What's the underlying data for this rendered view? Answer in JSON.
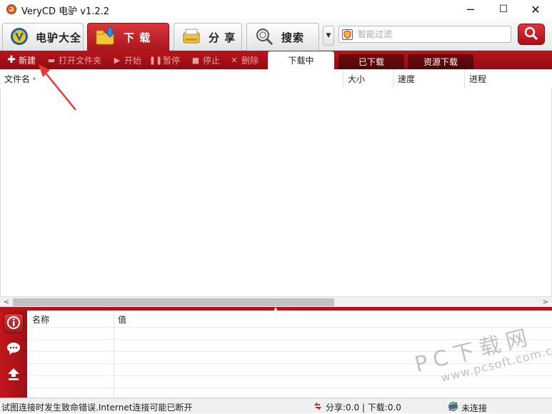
{
  "window": {
    "title": "VeryCD 电驴 v1.2.2",
    "minimize_glyph": "─",
    "maximize_glyph": "☐",
    "close_glyph": "✕"
  },
  "main_tabs": [
    {
      "label": "电驴大全",
      "icon": "verycd-logo-icon",
      "active": false
    },
    {
      "label": "下 载",
      "icon": "download-folder-icon",
      "active": true
    },
    {
      "label": "分 享",
      "icon": "share-drive-icon",
      "active": false
    },
    {
      "label": "搜索",
      "icon": "search-magnifier-icon",
      "active": false
    }
  ],
  "tab_dropdown_glyph": "▼",
  "filter": {
    "placeholder": "智能过滤",
    "value": ""
  },
  "toolbar": {
    "new_label": "新建",
    "open_folder_label": "打开文件夹",
    "start_label": "开始",
    "pause_label": "暂停",
    "stop_label": "停止",
    "delete_label": "删除"
  },
  "sub_tabs": {
    "downloading": "下载中",
    "downloaded": "已下载",
    "resource": "资源下载"
  },
  "list": {
    "columns": [
      "文件名",
      "大小",
      "速度",
      "进程"
    ],
    "rows": []
  },
  "scroll_glyphs": {
    "left": "<",
    "right": ">",
    "grip": "▲"
  },
  "properties": {
    "columns": [
      "名称",
      "值"
    ],
    "rows": []
  },
  "status": {
    "message": "试图连接时发生致命错误.Internet连接可能已断开",
    "transfer": "分享:0.0 | 下载:0.0",
    "connection": "未连接"
  },
  "watermark": {
    "main": "PC下载网",
    "sub": "www.pcsoft.com.cn"
  },
  "colors": {
    "accent_red": "#b1161c",
    "dark_red": "#8f0d12",
    "tab_inactive": "#6d0a0e"
  }
}
